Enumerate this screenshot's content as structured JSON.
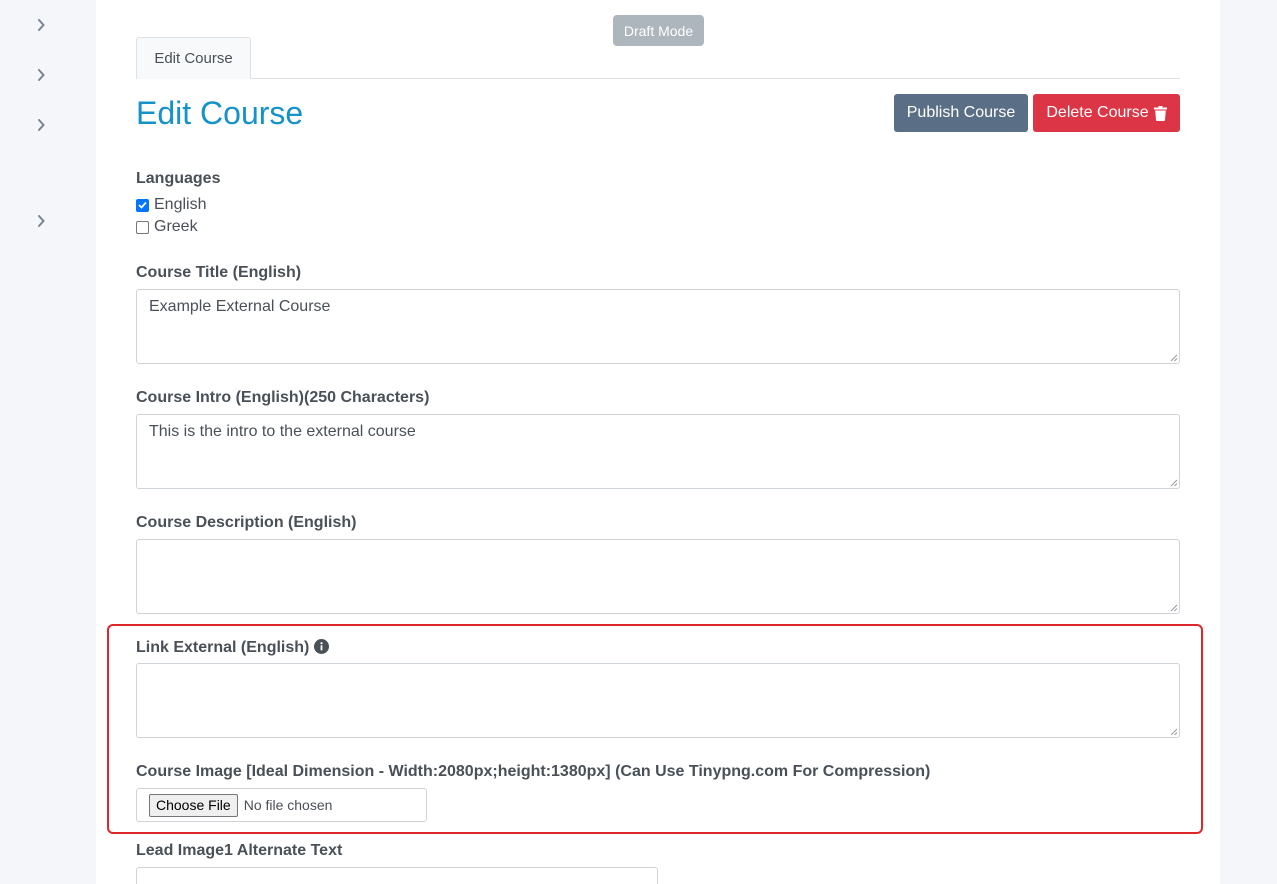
{
  "status_badge": "Draft Mode",
  "tabs": [
    {
      "label": "Edit Course"
    }
  ],
  "page_title": "Edit Course",
  "actions": {
    "publish_label": "Publish Course",
    "delete_label": "Delete Course",
    "delete_icon": "trash-icon"
  },
  "languages": {
    "label": "Languages",
    "options": [
      {
        "label": "English",
        "checked": true
      },
      {
        "label": "Greek",
        "checked": false
      }
    ]
  },
  "fields": {
    "course_title": {
      "label": "Course Title (English)",
      "value": "Example External Course"
    },
    "course_intro": {
      "label": "Course Intro (English)(250 Characters)",
      "value": "This is the intro to the external course"
    },
    "course_description": {
      "label": "Course Description (English)",
      "value": ""
    },
    "link_external": {
      "label": "Link External (English)",
      "value": "",
      "icon": "info-icon"
    },
    "course_image": {
      "label": "Course Image [Ideal Dimension - Width:2080px;height:1380px] (Can Use Tinypng.com For Compression)",
      "button": "Choose File",
      "status": "No file chosen"
    },
    "lead_image_alt": {
      "label": "Lead Image1 Alternate Text",
      "value": ""
    }
  },
  "colors": {
    "accent": "#1593c8",
    "publish": "#5a6f85",
    "delete": "#dc3545",
    "highlight": "#e0262d",
    "badge": "#adb5bd"
  }
}
